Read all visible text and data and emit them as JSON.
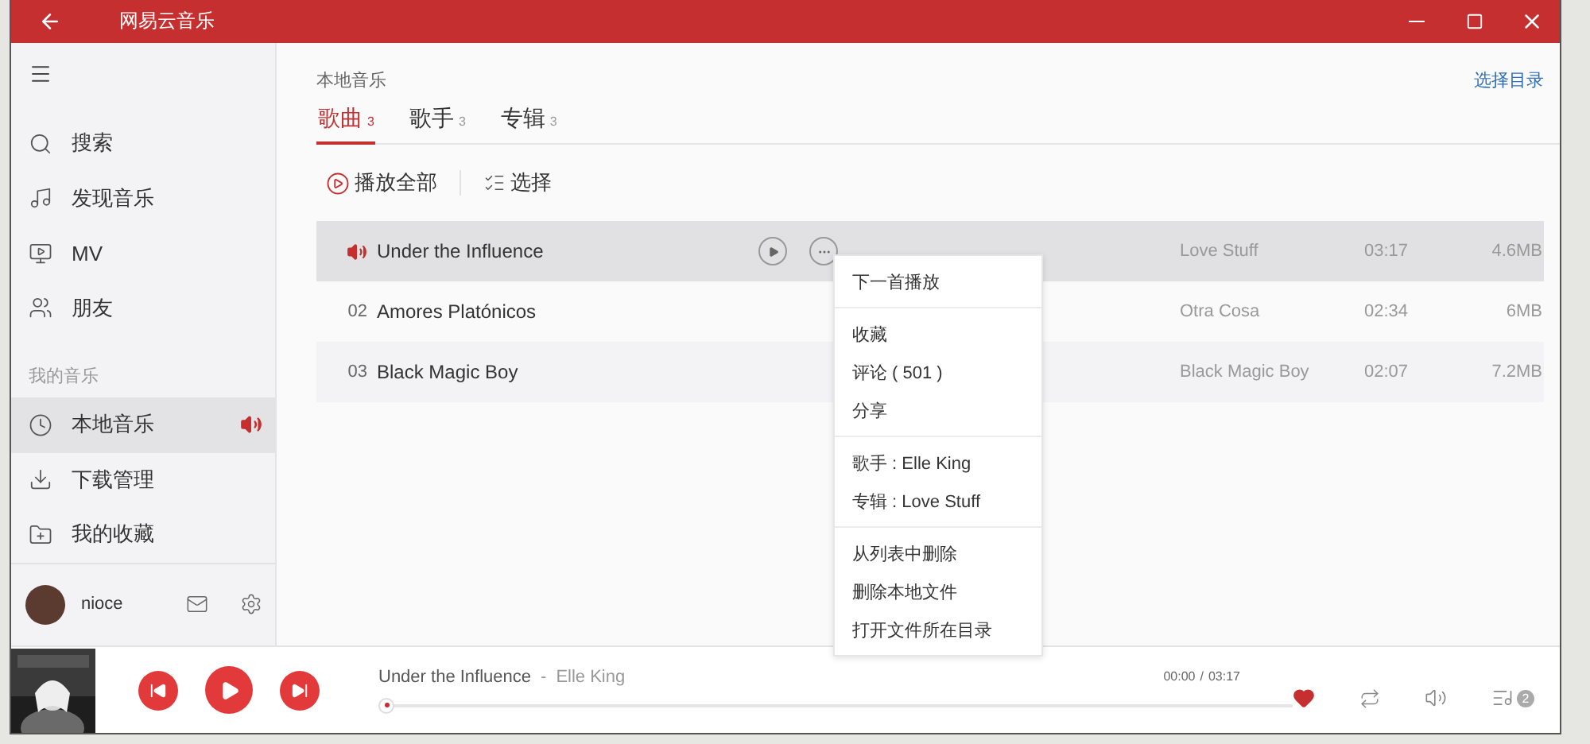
{
  "window": {
    "title": "网易云音乐"
  },
  "sidebar": {
    "items": [
      {
        "label": "搜索",
        "selected": false,
        "playing": false
      },
      {
        "label": "发现音乐",
        "selected": false,
        "playing": false
      },
      {
        "label": "MV",
        "selected": false,
        "playing": false
      },
      {
        "label": "朋友",
        "selected": false,
        "playing": false
      }
    ],
    "section": "我的音乐",
    "my_items": [
      {
        "label": "本地音乐",
        "selected": true,
        "playing": true
      },
      {
        "label": "下载管理",
        "selected": false,
        "playing": false
      },
      {
        "label": "我的收藏",
        "selected": false,
        "playing": false
      }
    ],
    "user": {
      "name": "nioce"
    }
  },
  "page": {
    "title": "本地音乐",
    "link": "选择目录",
    "tabs": [
      {
        "label": "歌曲",
        "count": "3",
        "selected": true
      },
      {
        "label": "歌手",
        "count": "3",
        "selected": false
      },
      {
        "label": "专辑",
        "count": "3",
        "selected": false
      }
    ],
    "actions": [
      "播放全部",
      "选择"
    ],
    "songs": [
      {
        "title": "Under the Influence",
        "album": "Love Stuff",
        "duration": "03:17",
        "size": "4.6MB",
        "selected": true,
        "playing": true
      },
      {
        "number": "02",
        "title": "Amores Platónicos",
        "album": "Otra Cosa",
        "duration": "02:34",
        "size": "6MB",
        "selected": false,
        "playing": false
      },
      {
        "number": "03",
        "title": "Black Magic Boy",
        "album": "Black Magic Boy",
        "duration": "02:07",
        "size": "7.2MB",
        "selected": false,
        "playing": false
      }
    ]
  },
  "context_menu": {
    "groups": [
      [
        "下一首播放"
      ],
      [
        "收藏",
        "评论 ( 501 )",
        "分享"
      ],
      [
        "歌手 : Elle King",
        "专辑 : Love Stuff"
      ],
      [
        "从列表中删除",
        "删除本地文件",
        "打开文件所在目录"
      ]
    ]
  },
  "player": {
    "title": "Under the Influence",
    "separator": "-",
    "artist": "Elle King",
    "time_separator": "/",
    "position": "00:00",
    "total": "03:17",
    "level": 0,
    "liked": true,
    "queue_count": "2"
  }
}
